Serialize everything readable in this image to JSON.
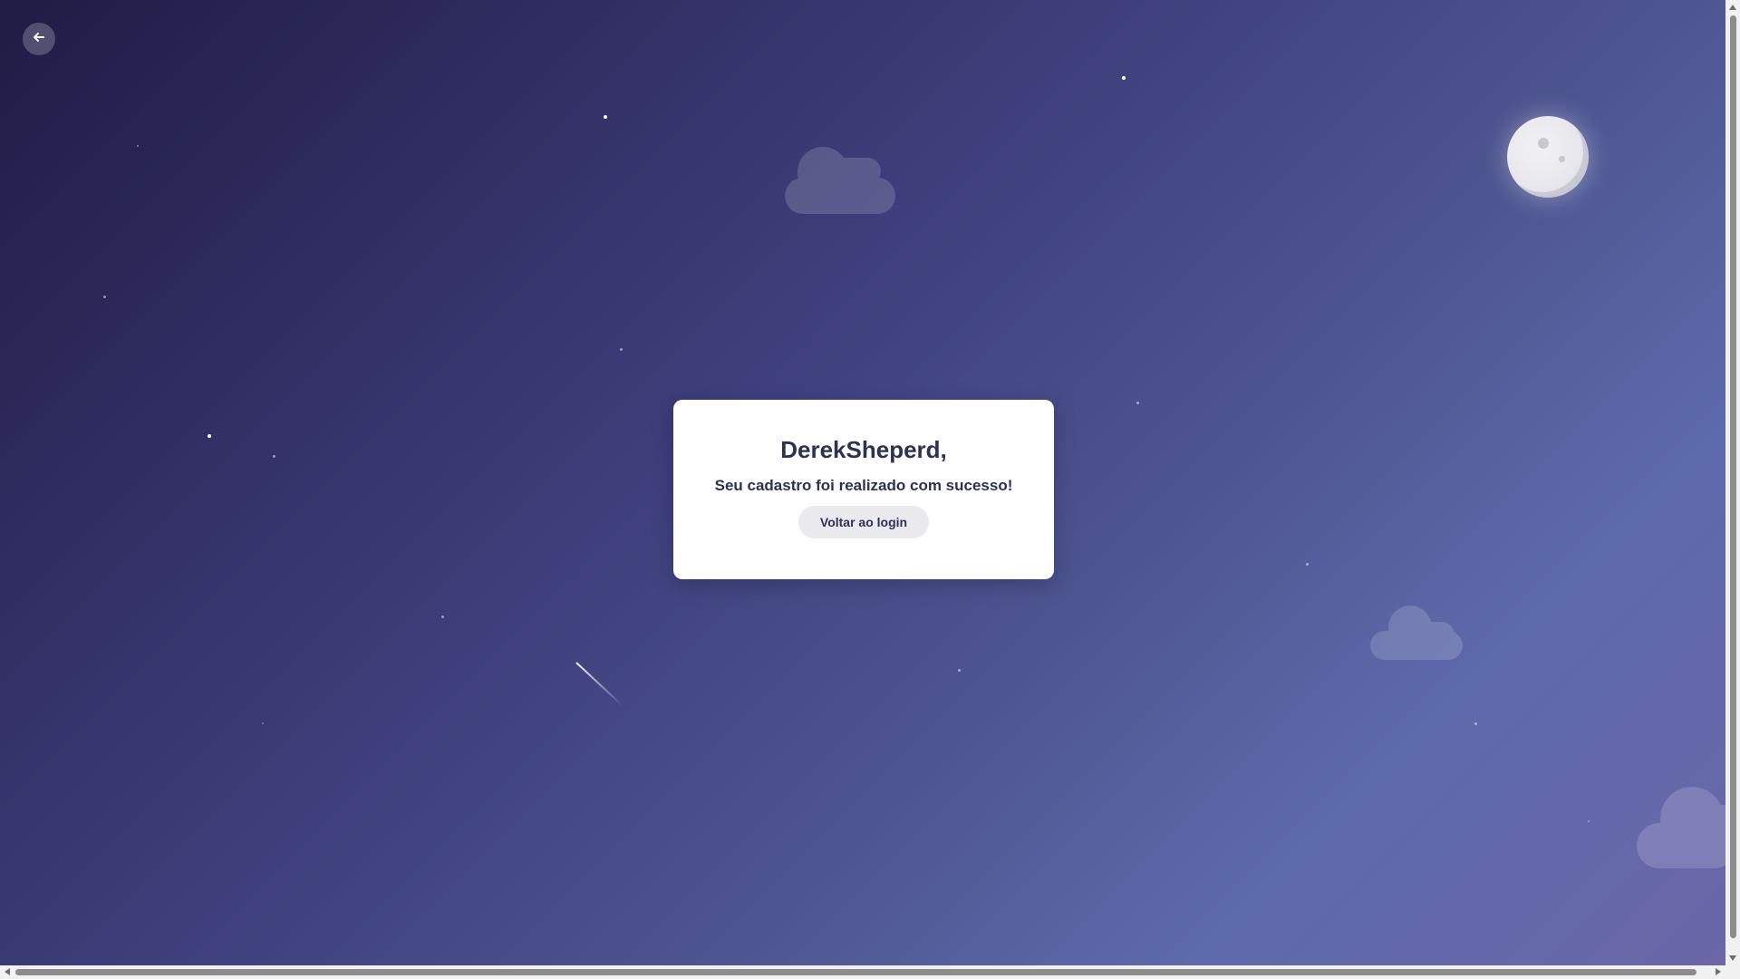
{
  "back_button": {
    "icon": "arrow-left-icon"
  },
  "card": {
    "title": "DerekSheperd,",
    "message": "Seu cadastro foi realizado com sucesso!",
    "login_button_label": "Voltar ao login"
  },
  "colors": {
    "text": "#2b3254",
    "card_background": "#ffffff",
    "button_background": "#e9e9ee"
  }
}
